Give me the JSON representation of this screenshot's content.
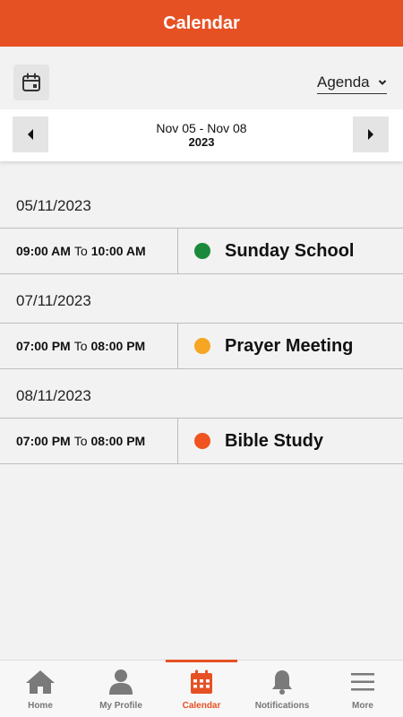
{
  "header": {
    "title": "Calendar"
  },
  "toolbar": {
    "calendar_icon": "calendar-icon",
    "view_selected": "Agenda"
  },
  "nav": {
    "range": "Nov 05 - Nov 08",
    "year": "2023"
  },
  "agenda": [
    {
      "date": "05/11/2023",
      "events": [
        {
          "start": "09:00 AM",
          "to": "To",
          "end": "10:00 AM",
          "title": "Sunday School",
          "color": "#1a8a3a"
        }
      ]
    },
    {
      "date": "07/11/2023",
      "events": [
        {
          "start": "07:00 PM",
          "to": "To",
          "end": "08:00 PM",
          "title": "Prayer Meeting",
          "color": "#f5a623"
        }
      ]
    },
    {
      "date": "08/11/2023",
      "events": [
        {
          "start": "07:00 PM",
          "to": "To",
          "end": "08:00 PM",
          "title": "Bible Study",
          "color": "#f0531f"
        }
      ]
    }
  ],
  "tabs": [
    {
      "label": "Home",
      "icon": "home-icon"
    },
    {
      "label": "My Profile",
      "icon": "user-icon"
    },
    {
      "label": "Calendar",
      "icon": "calendar-icon",
      "active": true
    },
    {
      "label": "Notifications",
      "icon": "bell-icon"
    },
    {
      "label": "More",
      "icon": "menu-icon"
    }
  ],
  "colors": {
    "accent": "#e65124"
  }
}
